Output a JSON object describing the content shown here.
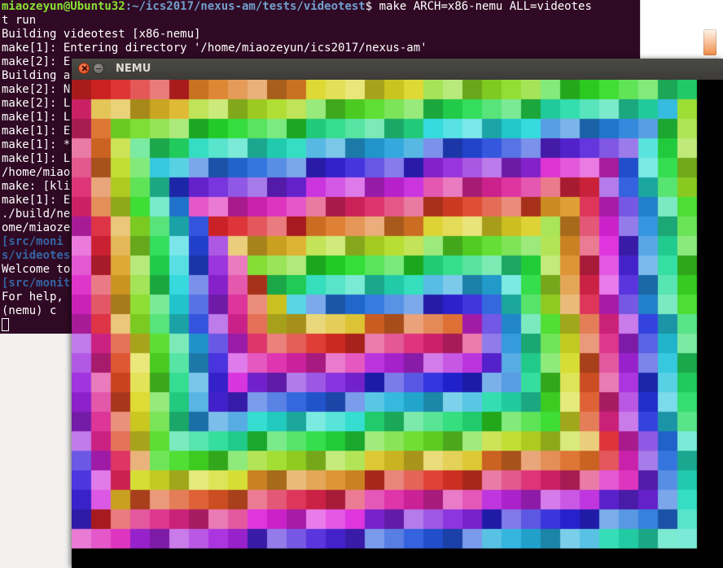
{
  "terminal": {
    "prompt_user": "miaozeyun@Ubuntu32",
    "prompt_path": ":~/ics2017/nexus-am/tests/videotest",
    "prompt_symbol": "$",
    "command": " make ARCH=x86-nemu ALL=videotes",
    "lines": [
      "t run",
      "Building videotest [x86-nemu]",
      "make[1]: Entering directory '/home/miaozeyun/ics2017/nexus-am'",
      "make[2]: E",
      "Building a",
      "make[2]: N",
      "make[2]: L",
      "make[1]: L",
      "make[1]: E",
      "make[1]: *",
      "make[1]: L",
      "/home/miao",
      "make: [kli",
      "make[1]: E",
      "./build/ne",
      "ome/miaoze"
    ],
    "blue_line_1": "[src/moni",
    "blue_line_2": "s/videotes",
    "welcome_line": "Welcome to",
    "blue_line_3": "[src/monit",
    "help_line": "For help, ",
    "nemu_prompt": "(nemu) c"
  },
  "nemu_window": {
    "title": "NEMU",
    "close_icon": "close-icon",
    "minimize_icon": "minimize-icon"
  },
  "colors": {
    "terminal_bg": "#300a24",
    "prompt_user": "#8ae234",
    "prompt_path": "#729fcf",
    "titlebar_bg": "#3c3b37",
    "title_text": "#dfdbd2"
  }
}
